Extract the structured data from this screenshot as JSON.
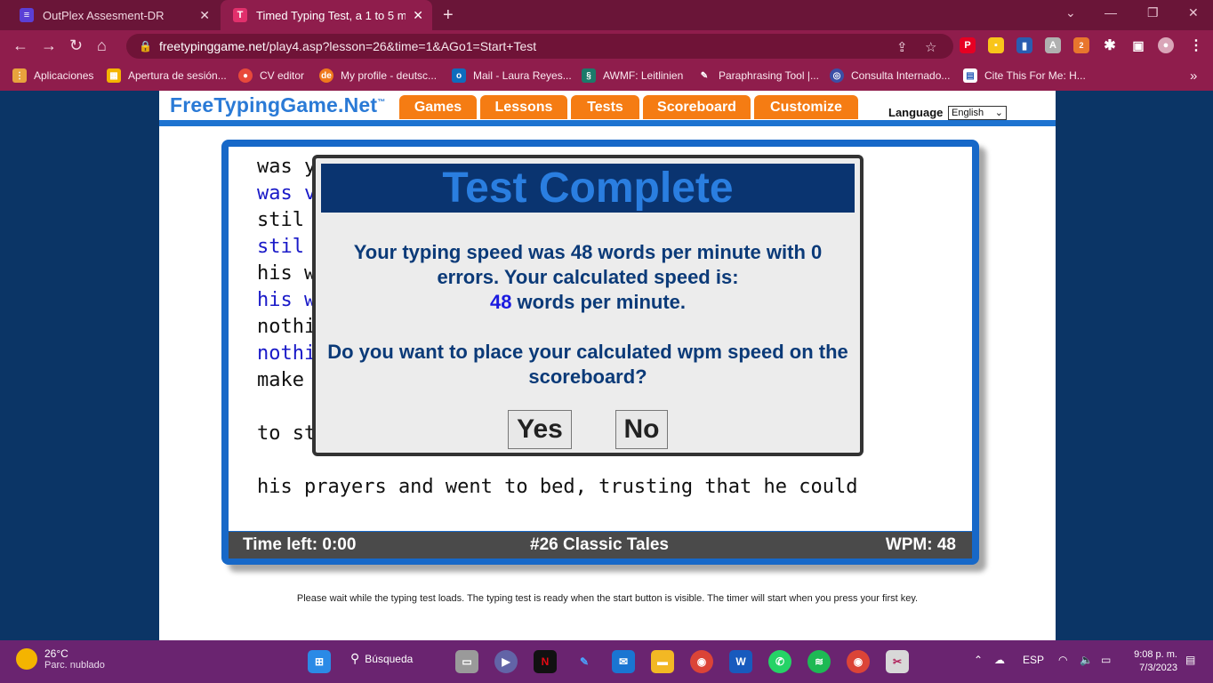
{
  "browser": {
    "tabs": [
      {
        "title": "OutPlex Assesment-DR",
        "close": "✕",
        "favicon": "list-icon"
      },
      {
        "title": "Timed Typing Test, a 1 to 5 minut",
        "close": "✕",
        "favicon": "T",
        "active": true
      }
    ],
    "new_tab": "+",
    "url_host": "freetypinggame.net",
    "url_path": "/play4.asp?lesson=26&time=1&AGo1=Start+Test",
    "bookmarks": [
      "Aplicaciones",
      "Apertura de sesión...",
      "CV editor",
      "My profile - deutsc...",
      "Mail - Laura Reyes...",
      "AWMF: Leitlinien",
      "Paraphrasing Tool |...",
      "Consulta Internado...",
      "Cite This For Me: H..."
    ],
    "bookmarks_more": "»",
    "extension_badge": "2"
  },
  "site": {
    "logo": "FreeTypingGame.Net",
    "logo_tm": "™",
    "nav": [
      "Games",
      "Lessons",
      "Tests",
      "Scoreboard",
      "Customize"
    ],
    "language_label": "Language",
    "language_value": "English"
  },
  "typing": {
    "lines": [
      {
        "text": "was y                               nd",
        "style": "plain"
      },
      {
        "text": "was v                               nd",
        "style": "blue"
      },
      {
        "text": "stil                                and",
        "style": "plain"
      },
      {
        "text": "stil                                and",
        "style": "blue"
      },
      {
        "text": "his w",
        "style": "plain"
      },
      {
        "text": "his w",
        "style": "blue"
      },
      {
        "text": "nothi                                gh to",
        "style": "plain"
      },
      {
        "text": "nothi",
        "style": "blue"
      },
      {
        "text": "make                                eady",
        "style": "plain"
      },
      {
        "text": "",
        "style": "plain"
      },
      {
        "text": "to st                               said",
        "style": "plain"
      },
      {
        "text": "",
        "style": "plain"
      },
      {
        "text": "his prayers and went to bed, trusting that he could",
        "style": "plain"
      }
    ],
    "time_left": "Time left: 0:00",
    "lesson": "#26 Classic Tales",
    "wpm": "WPM: 48"
  },
  "modal": {
    "title": "Test Complete",
    "msg_line1": "Your typing speed was 48 words per minute with 0",
    "msg_line2": "errors. Your calculated speed is:",
    "speed_value": "48",
    "speed_unit": " words per minute.",
    "question": "Do you want to place your calculated wpm speed on the scoreboard?",
    "yes": "Yes",
    "no": "No"
  },
  "notice": "Please wait while the typing test loads. The typing test is ready when the start button is visible. The timer will start when you press your first key.",
  "taskbar": {
    "temperature": "26°C",
    "condition": "Parc. nublado",
    "search": "Búsqueda",
    "language": "ESP",
    "time": "9:08 p. m.",
    "date": "7/3/2023"
  }
}
